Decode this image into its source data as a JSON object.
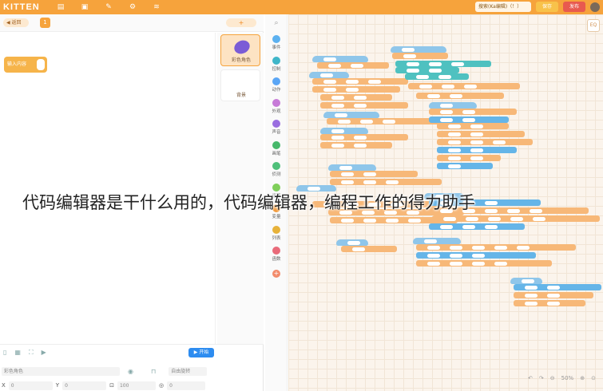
{
  "topbar": {
    "logo": "KITTEN",
    "project_name": "搜索(Ka编辑)（！）",
    "save_label": "保存",
    "publish_label": "发布"
  },
  "stage": {
    "back_label": "◀ 返回",
    "scene_tab": "1",
    "add_label": "+",
    "input_block_label": "输入内容",
    "sprites": [
      {
        "label": "彩色角色"
      },
      {
        "label": "背景"
      }
    ],
    "run_label": "▶ 开始",
    "props": {
      "name_value": "彩色角色",
      "rotate_label": "自由旋转",
      "x_label": "X",
      "x_value": "0",
      "y_label": "Y",
      "y_value": "0",
      "size_value": "100",
      "dir_value": "0"
    }
  },
  "categories": [
    {
      "name": "事件",
      "color": "#5cb1f0"
    },
    {
      "name": "控制",
      "color": "#3fb6c9"
    },
    {
      "name": "动作",
      "color": "#5aa6f6"
    },
    {
      "name": "外观",
      "color": "#c77bd8"
    },
    {
      "name": "声音",
      "color": "#9a6ee0"
    },
    {
      "name": "画笔",
      "color": "#47b86b"
    },
    {
      "name": "侦测",
      "color": "#4fc07a"
    },
    {
      "name": "运算",
      "color": "#7fcf5a"
    },
    {
      "name": "变量",
      "color": "#f29a3a"
    },
    {
      "name": "列表",
      "color": "#e7b23a"
    },
    {
      "name": "函数",
      "color": "#e96b7a"
    }
  ],
  "workspace": {
    "zoom": "50%",
    "corner_label": "EQ"
  },
  "caption": "代码编辑器是干什么用的，代码编辑器，编程工作的得力助手"
}
